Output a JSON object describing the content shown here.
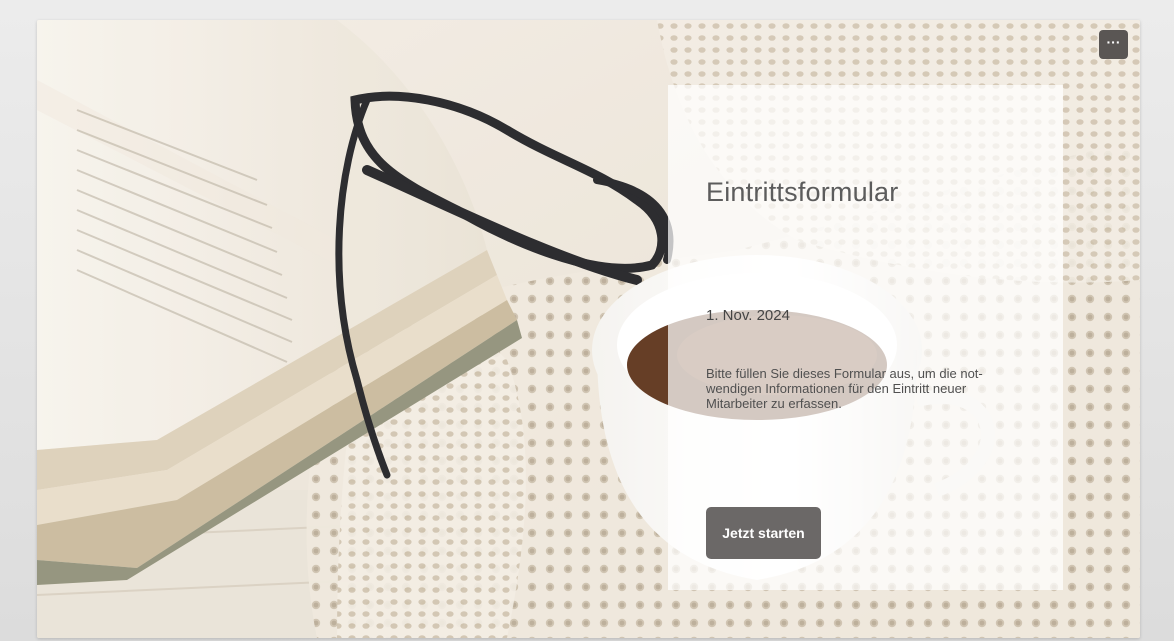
{
  "form": {
    "title": "Eintrittsformular",
    "date": "1. Nov. 2024",
    "description": "Bitte füllen Sie dieses Formular aus, um die not­wendigen Informationen für den Eintritt neuer Mitarbeiter zu erfassen.",
    "start_button_label": "Jetzt starten"
  },
  "menu": {
    "more_label": "···",
    "more_icon": "more-dots-icon"
  },
  "colors": {
    "panel_text": "#5c5c5c",
    "button_bg": "#6b6867",
    "menu_button_bg": "#5a5654"
  }
}
